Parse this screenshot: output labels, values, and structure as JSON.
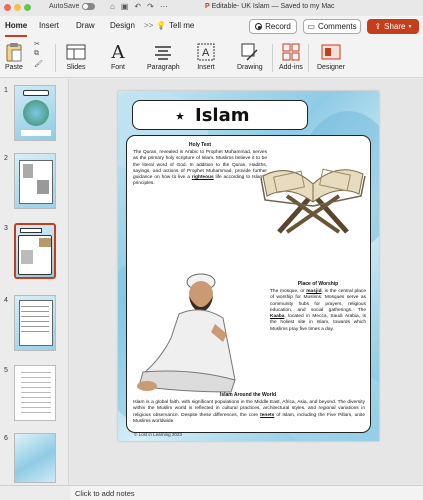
{
  "titlebar": {
    "autosave_label": "AutoSave",
    "document_title": "Editable- UK Islam — Saved to my Mac",
    "app_icon_label": "P"
  },
  "ribbon_tabs": {
    "home": "Home",
    "insert": "Insert",
    "draw": "Draw",
    "design": "Design",
    "more": ">>",
    "tell_me": "Tell me"
  },
  "actions": {
    "record": "Record",
    "comments": "Comments",
    "share": "Share"
  },
  "ribbon": {
    "paste": "Paste",
    "slides": "Slides",
    "font": "Font",
    "paragraph": "Paragraph",
    "insert": "Insert",
    "drawing": "Drawing",
    "addins": "Add-ins",
    "designer": "Designer"
  },
  "thumbnails": [
    {
      "number": "1"
    },
    {
      "number": "2"
    },
    {
      "number": "3"
    },
    {
      "number": "4"
    },
    {
      "number": "5"
    },
    {
      "number": "6"
    }
  ],
  "slide": {
    "title": "Islam",
    "holy_text": {
      "heading": "Holy Text",
      "body_1": "The Quran, revealed in Arabic to Prophet Muhammad, serves as the primary holy scripture of Islam. Muslims believe it to be the literal word of God. In addition to the Quran, Hadiths, sayings, and actions of Prophet Muhammad, provide further guidance on how to live a ",
      "emph": "righteous",
      "body_2": " life according to Islamic principles."
    },
    "worship": {
      "heading": "Place of Worship",
      "body_1": "The mosque, or ",
      "emph_1": "masjid",
      "body_2": ", is the central place of worship for Muslims. Mosques serve as community hubs for prayers, religious education, and social gatherings. The ",
      "emph_2": "Kaaba",
      "body_3": ", located in Mecca, Saudi Arabia, is the holiest site in Islam, towards which Muslims pray five times a day."
    },
    "world": {
      "heading": "Islam Around the World",
      "body_1": "Islam is a global faith, with significant populations in the Middle East, Africa, Asia, and beyond. The diversity within the Muslim world is reflected in cultural practices, architectural styles, and regional variations in religious observance. Despite these differences, the core ",
      "emph": "tenets",
      "body_2": " of Islam, including the Five Pillars, unite Muslims worldwide."
    },
    "copyright": "© Lost in Learning 2023"
  },
  "notes": {
    "placeholder": "Click to add notes"
  },
  "colors": {
    "accent": "#c43e1c",
    "slide_bg": "#8fcbe5"
  }
}
